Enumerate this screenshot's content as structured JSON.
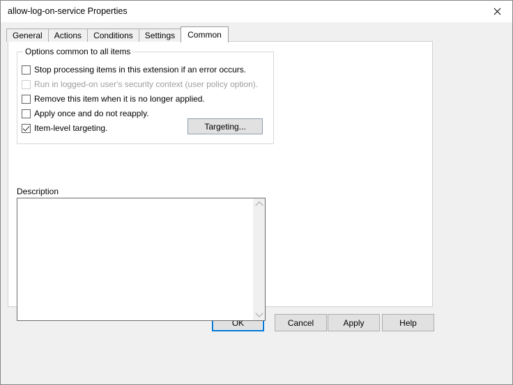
{
  "window": {
    "title": "allow-log-on-service Properties",
    "close_icon": "close-icon",
    "accent_color": "#0078d7"
  },
  "tabs": [
    {
      "label": "General",
      "selected": false
    },
    {
      "label": "Actions",
      "selected": false
    },
    {
      "label": "Conditions",
      "selected": false
    },
    {
      "label": "Settings",
      "selected": false
    },
    {
      "label": "Common",
      "selected": true
    }
  ],
  "group": {
    "legend": "Options common to all items",
    "options": [
      {
        "label": "Stop processing items in this extension if an error occurs.",
        "checked": false,
        "enabled": true
      },
      {
        "label": "Run in logged-on user's security context (user policy option).",
        "checked": false,
        "enabled": false
      },
      {
        "label": "Remove this item when it is no longer applied.",
        "checked": false,
        "enabled": true
      },
      {
        "label": "Apply once and do not reapply.",
        "checked": false,
        "enabled": true
      },
      {
        "label": "Item-level targeting.",
        "checked": true,
        "enabled": true
      }
    ],
    "targeting_button": "Targeting..."
  },
  "description": {
    "label": "Description",
    "value": "",
    "placeholder": "",
    "scroll_up_icon": "chevron-up-icon",
    "scroll_down_icon": "chevron-down-icon"
  },
  "buttons": {
    "ok": "OK",
    "cancel": "Cancel",
    "apply": "Apply",
    "help": "Help"
  }
}
